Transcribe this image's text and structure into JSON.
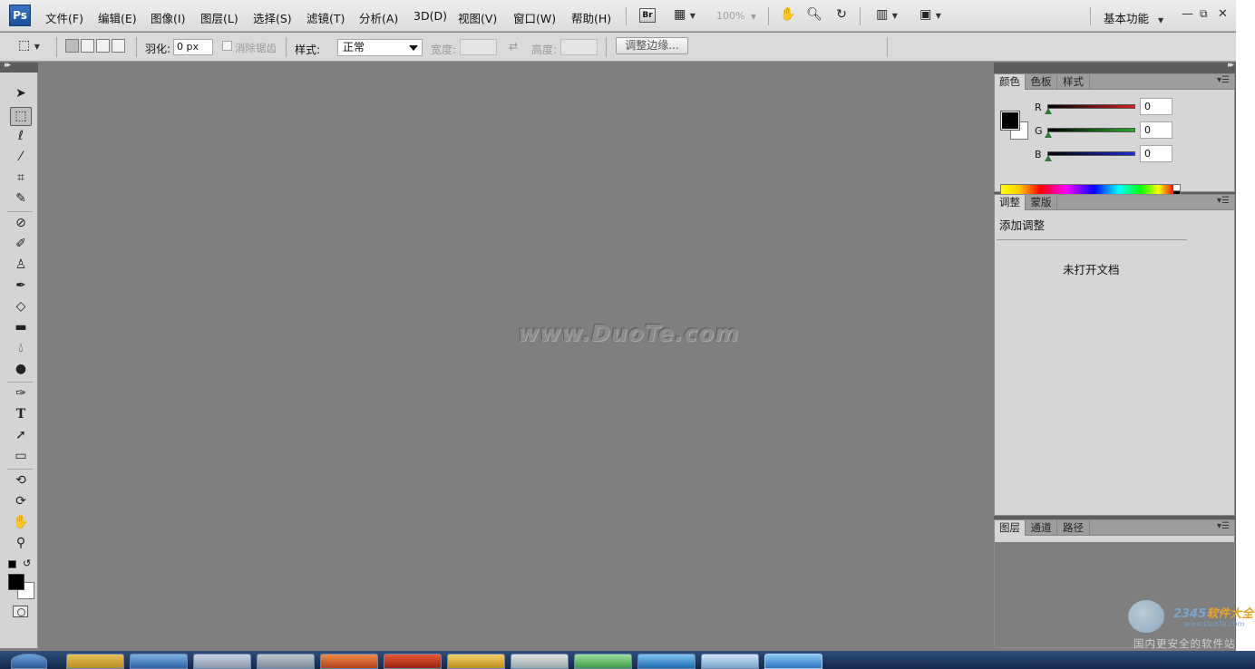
{
  "app": {
    "logo_text": "Ps"
  },
  "menubar": {
    "items": [
      {
        "label": "文件(F)"
      },
      {
        "label": "编辑(E)"
      },
      {
        "label": "图像(I)"
      },
      {
        "label": "图层(L)"
      },
      {
        "label": "选择(S)"
      },
      {
        "label": "滤镜(T)"
      },
      {
        "label": "分析(A)"
      },
      {
        "label": "3D(D)"
      },
      {
        "label": "视图(V)"
      },
      {
        "label": "窗口(W)"
      },
      {
        "label": "帮助(H)"
      }
    ],
    "bridge_label": "Br",
    "zoom": "100%",
    "workspace": "基本功能"
  },
  "options_bar": {
    "feather_label": "羽化:",
    "feather_value": "0 px",
    "antialias_label": "消除锯齿",
    "style_label": "样式:",
    "style_value": "正常",
    "width_label": "宽度:",
    "height_label": "高度:",
    "refine_edge": "调整边缘..."
  },
  "canvas": {
    "watermark": "www.DuoTe.com"
  },
  "color_panel": {
    "tabs": [
      "颜色",
      "色板",
      "样式"
    ],
    "channels": [
      {
        "name": "R",
        "value": "0",
        "color": "#d42020"
      },
      {
        "name": "G",
        "value": "0",
        "color": "#22b022"
      },
      {
        "name": "B",
        "value": "0",
        "color": "#1a2fd0"
      }
    ]
  },
  "adjust_panel": {
    "tabs": [
      "调整",
      "蒙版"
    ],
    "title": "添加调整",
    "message": "未打开文档"
  },
  "layers_panel": {
    "tabs": [
      "图层",
      "通道",
      "路径"
    ]
  },
  "corner_watermark": {
    "brand_num": "2345",
    "brand_text": "软件大全",
    "site": "www.DuoTe.com",
    "slogan": "国内更安全的软件站"
  }
}
